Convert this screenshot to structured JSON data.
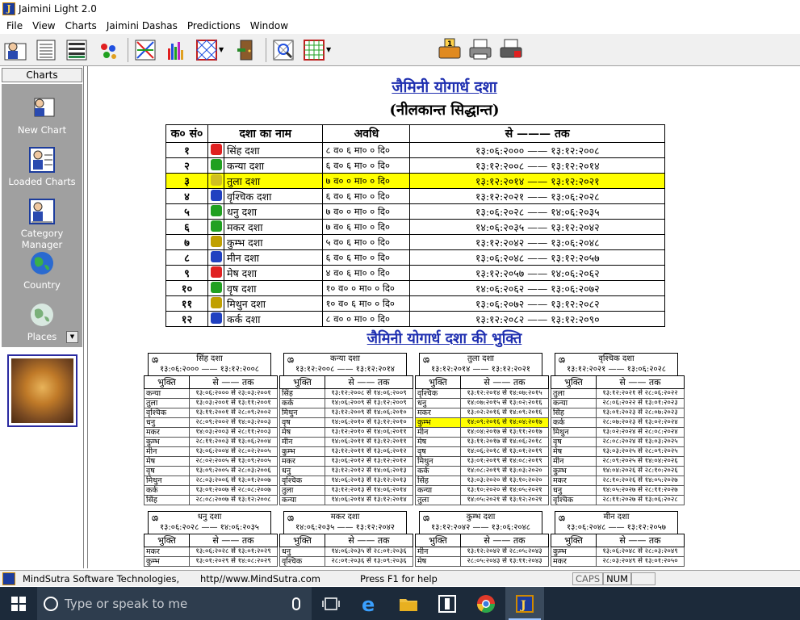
{
  "window": {
    "title": "Jaimini Light 2.0"
  },
  "menu": [
    "File",
    "View",
    "Charts",
    "Jaimini Dashas",
    "Predictions",
    "Window"
  ],
  "sidebar": {
    "header": "Charts",
    "items": [
      {
        "label": "New Chart",
        "icon": "new-chart-icon"
      },
      {
        "label": "Loaded Charts",
        "icon": "loaded-charts-icon"
      },
      {
        "label": "Category Manager",
        "icon": "category-manager-icon"
      },
      {
        "label": "Country",
        "icon": "globe-icon"
      },
      {
        "label": "Places",
        "icon": "places-globe-icon"
      }
    ]
  },
  "content": {
    "title": "जैमिनी योगार्ध दशा",
    "subtitle": "(नीलकान्त सिद्धान्त)",
    "table_headers": [
      "क० सं०",
      "दशा का नाम",
      "अवधि",
      "से ——— तक"
    ],
    "dashas": [
      {
        "n": "१",
        "name": "सिंह दशा",
        "color": "#e02020",
        "dur": "८ व० ६ मा० ० दि०",
        "range": "१३:०६:२००० —— १३:१२:२००८",
        "hl": false
      },
      {
        "n": "२",
        "name": "कन्या दशा",
        "color": "#20a020",
        "dur": "६ व० ६ मा० ० दि०",
        "range": "१३:१२:२००८ —— १३:१२:२०१४",
        "hl": false
      },
      {
        "n": "३",
        "name": "तुला दशा",
        "color": "#d0c020",
        "dur": "७ व० ० मा० ० दि०",
        "range": "१३:१२:२०१४ —— १३:१२:२०२१",
        "hl": true
      },
      {
        "n": "४",
        "name": "वृश्चिक दशा",
        "color": "#2040c0",
        "dur": "६ व० ६ मा० ० दि०",
        "range": "१३:१२:२०२१ —— १३:०६:२०२८",
        "hl": false
      },
      {
        "n": "५",
        "name": "धनु दशा",
        "color": "#20a020",
        "dur": "७ व० ० मा० ० दि०",
        "range": "१३:०६:२०२८ —— १४:०६:२०३५",
        "hl": false
      },
      {
        "n": "६",
        "name": "मकर दशा",
        "color": "#20a020",
        "dur": "७ व० ६ मा० ० दि०",
        "range": "१४:०६:२०३५ —— १३:१२:२०४२",
        "hl": false
      },
      {
        "n": "७",
        "name": "कुम्भ दशा",
        "color": "#c0a000",
        "dur": "५ व० ६ मा० ० दि०",
        "range": "१३:१२:२०४२ —— १३:०६:२०४८",
        "hl": false
      },
      {
        "n": "८",
        "name": "मीन दशा",
        "color": "#2040c0",
        "dur": "६ व० ६ मा० ० दि०",
        "range": "१३:०६:२०४८ —— १३:१२:२०५७",
        "hl": false
      },
      {
        "n": "९",
        "name": "मेष दशा",
        "color": "#e02020",
        "dur": "४ व० ६ मा० ० दि०",
        "range": "१३:१२:२०५७ —— १४:०६:२०६२",
        "hl": false
      },
      {
        "n": "१०",
        "name": "वृष दशा",
        "color": "#20a020",
        "dur": "१० व० ० मा० ० दि०",
        "range": "१४:०६:२०६२ —— १३:०६:२०७२",
        "hl": false
      },
      {
        "n": "११",
        "name": "मिथुन दशा",
        "color": "#c0a000",
        "dur": "१० व० ६ मा० ० दि०",
        "range": "१३:०६:२०७२ —— १३:१२:२०८२",
        "hl": false
      },
      {
        "n": "१२",
        "name": "कर्क दशा",
        "color": "#2040c0",
        "dur": "८ व० ० मा० ० दि०",
        "range": "१३:१२:२०८२ —— १३:१२:२०९०",
        "hl": false
      }
    ],
    "bhukti_title": "जैमिनी योगार्ध दशा की भुक्ति",
    "bhukti_headers": [
      "भुक्ति",
      "से —— तक"
    ],
    "bhukti_blocks": [
      {
        "icon": "ශ",
        "name": "सिंह दशा",
        "range": "१३:०६:२००० —— १३:१२:२००८",
        "rows": [
          {
            "p": "कन्या",
            "r": "१३:०६:२००० से २३:०३:२००१"
          },
          {
            "p": "तुला",
            "r": "१३:०३:२००१ से १३:११:२००१"
          },
          {
            "p": "वृश्चिक",
            "r": "१३:११:२००१ से २८:०९:२००२"
          },
          {
            "p": "धनु",
            "r": "२८:०९:२००२ से १४:०३:२००३"
          },
          {
            "p": "मकर",
            "r": "१४:०३:२००३ से २८:११:२००३"
          },
          {
            "p": "कुम्भ",
            "r": "२८:११:२००३ से १३:०६:२००४"
          },
          {
            "p": "मीन",
            "r": "१३:०६:२००४ से २८:०२:२००५"
          },
          {
            "p": "मेष",
            "r": "२८:०२:२००५ से १३:०९:२००५"
          },
          {
            "p": "वृष",
            "r": "१३:०९:२००५ से २८:०३:२००६"
          },
          {
            "p": "मिथुन",
            "r": "२८:०३:२००६ से १३:०१:२००७"
          },
          {
            "p": "कर्क",
            "r": "१३:०१:२००७ से २८:०८:२००७"
          },
          {
            "p": "सिंह",
            "r": "२८:०८:२००७ से १३:१२:२००८"
          }
        ]
      },
      {
        "icon": "ශ",
        "name": "कन्या दशा",
        "range": "१३:१२:२००८ —— १३:१२:२०१४",
        "rows": [
          {
            "p": "सिंह",
            "r": "१३:१२:२००८ से १४:०६:२००९"
          },
          {
            "p": "कर्क",
            "r": "१४:०६:२००९ से १३:१२:२००९"
          },
          {
            "p": "मिथुन",
            "r": "१३:१२:२००९ से १४:०६:२०१०"
          },
          {
            "p": "वृष",
            "r": "१४:०६:२०१० से १३:१२:२०१०"
          },
          {
            "p": "मेष",
            "r": "१३:१२:२०१० से १४:०६:२०११"
          },
          {
            "p": "मीन",
            "r": "१४:०६:२०११ से १३:१२:२०११"
          },
          {
            "p": "कुम्भ",
            "r": "१३:१२:२०११ से १३:०६:२०१२"
          },
          {
            "p": "मकर",
            "r": "१३:०६:२०१२ से १३:१२:२०१२"
          },
          {
            "p": "धनु",
            "r": "१३:१२:२०१२ से १४:०६:२०१३"
          },
          {
            "p": "वृश्चिक",
            "r": "१४:०६:२०१३ से १३:१२:२०१३"
          },
          {
            "p": "तुला",
            "r": "१३:१२:२०१३ से १४:०६:२०१४"
          },
          {
            "p": "कन्या",
            "r": "१४:०६:२०१४ से १३:१२:२०१४"
          }
        ]
      },
      {
        "icon": "ශ",
        "name": "तुला दशा",
        "range": "१३:१२:२०१४ —— १३:१२:२०२१",
        "rows": [
          {
            "p": "वृश्चिक",
            "r": "१३:१२:२०१४ से १४:०७:२०१५"
          },
          {
            "p": "धनु",
            "r": "१४:०७:२०१५ से १३:०२:२०१६"
          },
          {
            "p": "मकर",
            "r": "१३:०२:२०१६ से १४:०९:२०१६"
          },
          {
            "p": "कुम्भ",
            "r": "१४:०९:२०१६ से १४:०४:२०१७",
            "hl": true
          },
          {
            "p": "मीन",
            "r": "१४:०४:२०१७ से १३:११:२०१७"
          },
          {
            "p": "मेष",
            "r": "१३:११:२०१७ से १४:०६:२०१८"
          },
          {
            "p": "वृष",
            "r": "१४:०६:२०१८ से १३:०१:२०१९"
          },
          {
            "p": "मिथुन",
            "r": "१३:०१:२०१९ से १४:०८:२०१९"
          },
          {
            "p": "कर्क",
            "r": "१४:०८:२०१९ से १३:०३:२०२०"
          },
          {
            "p": "सिंह",
            "r": "१३:०३:२०२० से १३:१०:२०२०"
          },
          {
            "p": "कन्या",
            "r": "१३:१०:२०२० से १४:०५:२०२१"
          },
          {
            "p": "तुला",
            "r": "१४:०५:२०२१ से १३:१२:२०२१"
          }
        ]
      },
      {
        "icon": "ශ",
        "name": "वृश्चिक दशा",
        "range": "१३:१२:२०२१ —— १३:०६:२०२८",
        "rows": [
          {
            "p": "तुला",
            "r": "१३:१२:२०२१ से २८:०६:२०२२"
          },
          {
            "p": "कन्या",
            "r": "२८:०६:२०२२ से १३:०१:२०२३"
          },
          {
            "p": "सिंह",
            "r": "१३:०१:२०२३ से २८:०७:२०२३"
          },
          {
            "p": "कर्क",
            "r": "२८:०७:२०२३ से १३:०२:२०२४"
          },
          {
            "p": "मिथुन",
            "r": "१३:०२:२०२४ से २८:०८:२०२४"
          },
          {
            "p": "वृष",
            "r": "२८:०८:२०२४ से १३:०३:२०२५"
          },
          {
            "p": "मेष",
            "r": "१३:०३:२०२५ से २८:०९:२०२५"
          },
          {
            "p": "मीन",
            "r": "२८:०९:२०२५ से १४:०४:२०२६"
          },
          {
            "p": "कुम्भ",
            "r": "१४:०४:२०२६ से २८:१०:२०२६"
          },
          {
            "p": "मकर",
            "r": "२८:१०:२०२६ से १४:०५:२०२७"
          },
          {
            "p": "धनु",
            "r": "१४:०५:२०२७ से २८:११:२०२७"
          },
          {
            "p": "वृश्चिक",
            "r": "२८:११:२०२७ से १३:०६:२०२८"
          }
        ]
      },
      {
        "icon": "ශ",
        "name": "धनु दशा",
        "range": "१३:०६:२०२८ —— १४:०६:२०३५",
        "rows": [
          {
            "p": "मकर",
            "r": "१३:०६:२०२८ से १३:०१:२०२९"
          },
          {
            "p": "कुम्भ",
            "r": "१३:०१:२०२९ से १४:०८:२०२९"
          }
        ]
      },
      {
        "icon": "ශ",
        "name": "मकर दशा",
        "range": "१४:०६:२०३५ —— १३:१२:२०४२",
        "rows": [
          {
            "p": "धनु",
            "r": "१४:०६:२०३५ से २८:०१:२०३६"
          },
          {
            "p": "वृश्चिक",
            "r": "२८:०१:२०३६ से १३:०९:२०३६"
          }
        ]
      },
      {
        "icon": "ශ",
        "name": "कुम्भ दशा",
        "range": "१३:१२:२०४२ —— १३:०६:२०४८",
        "rows": [
          {
            "p": "मीन",
            "r": "१३:१२:२०४२ से २८:०५:२०४३"
          },
          {
            "p": "मेष",
            "r": "२८:०५:२०४३ से १३:११:२०४३"
          }
        ]
      },
      {
        "icon": "ශ",
        "name": "मीन दशा",
        "range": "१३:०६:२०४८ —— १३:१२:२०५७",
        "rows": [
          {
            "p": "कुम्भ",
            "r": "१३:०६:२०४८ से २८:०३:२०४९"
          },
          {
            "p": "मकर",
            "r": "२८:०३:२०४९ से १३:०१:२०५०"
          }
        ]
      }
    ]
  },
  "status": {
    "company": "MindSutra Software Technologies,",
    "url": "http//www.MindSutra.com",
    "help": "Press F1 for help",
    "caps": "CAPS",
    "num": "NUM"
  },
  "taskbar": {
    "search_placeholder": "Type or speak to me"
  }
}
